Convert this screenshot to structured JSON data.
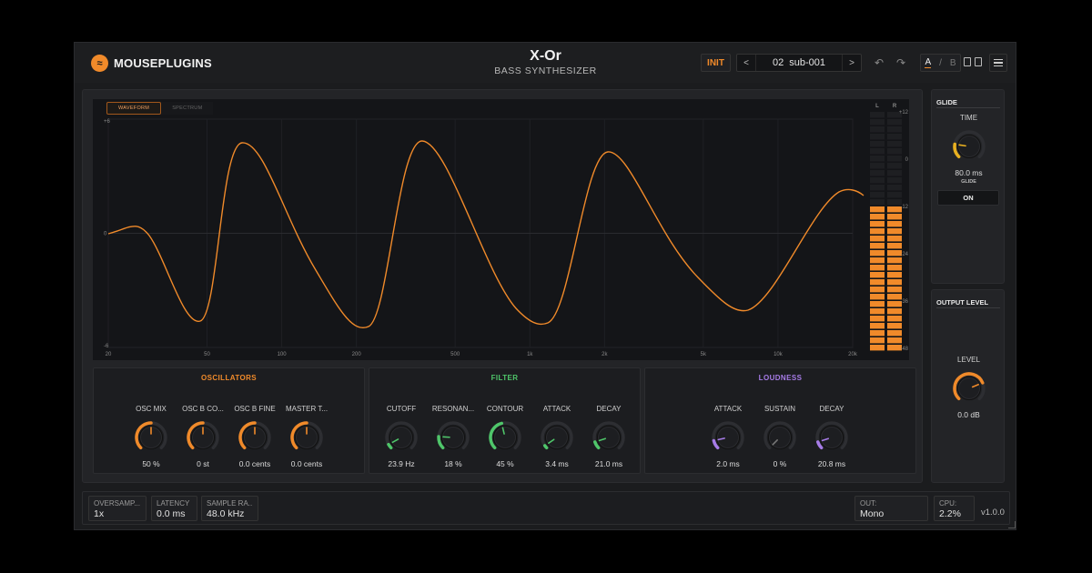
{
  "header": {
    "brand": "MOUSEPLUGINS",
    "title": "X-Or",
    "subtitle": "BASS SYNTHESIZER",
    "init_label": "INIT",
    "preset_prev": "<",
    "preset_next": ">",
    "preset_number": "02",
    "preset_name": "sub-001",
    "ab_a": "A",
    "ab_sep": "/",
    "ab_b": "B"
  },
  "display": {
    "tabs": [
      {
        "label": "WAVEFORM",
        "active": true
      },
      {
        "label": "SPECTRUM",
        "active": false
      }
    ],
    "y_labels": [
      "+6",
      "0",
      "-6"
    ],
    "x_labels": [
      "20",
      "50",
      "100",
      "200",
      "500",
      "1k",
      "2k",
      "5k",
      "10k",
      "20k"
    ],
    "meter_channels": [
      "L",
      "R"
    ],
    "meter_scale": [
      "+12",
      "0",
      "-12",
      "-24",
      "-36",
      "-48"
    ],
    "meter_level_db": -12,
    "wave_color": "#f08a2a"
  },
  "sections": {
    "oscillators": {
      "title": "OSCILLATORS",
      "color": "#f08a2a",
      "knobs": [
        {
          "label": "OSC MIX",
          "value": "50 %",
          "fraction": 0.5
        },
        {
          "label": "OSC B CO...",
          "value": "0 st",
          "fraction": 0.5
        },
        {
          "label": "OSC B FINE",
          "value": "0.0 cents",
          "fraction": 0.5
        },
        {
          "label": "MASTER T...",
          "value": "0.0 cents",
          "fraction": 0.5
        }
      ]
    },
    "filter": {
      "title": "FILTER",
      "color": "#4fc66a",
      "knobs": [
        {
          "label": "CUTOFF",
          "value": "23.9 Hz",
          "fraction": 0.06
        },
        {
          "label": "RESONAN...",
          "value": "18 %",
          "fraction": 0.18
        },
        {
          "label": "CONTOUR",
          "value": "45 %",
          "fraction": 0.45
        },
        {
          "label": "ATTACK",
          "value": "3.4 ms",
          "fraction": 0.04
        },
        {
          "label": "DECAY",
          "value": "21.0 ms",
          "fraction": 0.1
        }
      ]
    },
    "loudness": {
      "title": "LOUDNESS",
      "color": "#a77ce8",
      "knobs": [
        {
          "label": "ATTACK",
          "value": "2.0 ms",
          "fraction": 0.12
        },
        {
          "label": "SUSTAIN",
          "value": "0 %",
          "fraction": 0.0
        },
        {
          "label": "DECAY",
          "value": "20.8 ms",
          "fraction": 0.1
        }
      ]
    }
  },
  "glide": {
    "title": "GLIDE",
    "knob_label": "TIME",
    "value": "80.0 ms",
    "fraction": 0.2,
    "toggle_label": "GLIDE",
    "toggle_value": "ON",
    "color": "#e8b020"
  },
  "output": {
    "title": "OUTPUT LEVEL",
    "knob_label": "LEVEL",
    "value": "0.0 dB",
    "fraction": 0.75,
    "color": "#f08a2a"
  },
  "footer": {
    "oversampling": {
      "label": "OVERSAMP...",
      "value": "1x"
    },
    "latency": {
      "label": "LATENCY",
      "value": "0.0 ms"
    },
    "sample_rate": {
      "label": "SAMPLE RA...",
      "value": "48.0 kHz"
    },
    "out": {
      "label": "OUT:",
      "value": "Mono"
    },
    "cpu": {
      "label": "CPU:",
      "value": "2.2%"
    },
    "version": "v1.0.0"
  }
}
